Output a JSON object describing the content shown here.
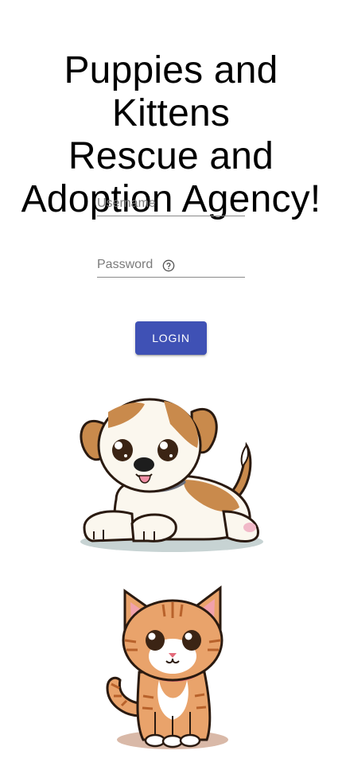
{
  "page": {
    "title_lines": [
      "Puppies and Kittens",
      "Rescue and",
      "Adoption Agency!"
    ]
  },
  "login_form": {
    "username": {
      "label": "Username",
      "value": ""
    },
    "password": {
      "label": "Password",
      "value": "",
      "help_icon": "help-circle-icon"
    },
    "login_button_label": "LOGIN",
    "accent_color": "#3f51b5"
  },
  "illustrations": [
    {
      "name": "puppy-illustration"
    },
    {
      "name": "kitten-illustration"
    }
  ]
}
